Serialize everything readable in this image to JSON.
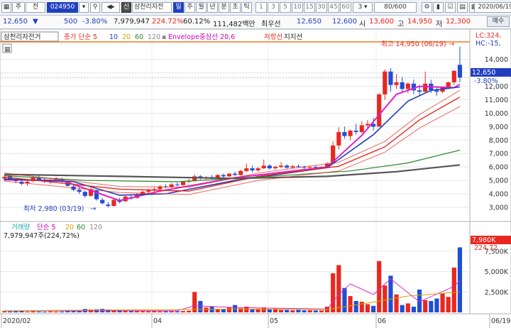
{
  "toolbar": {
    "menu_label": "주",
    "prev_label": "전",
    "code": "024950",
    "cat_badge": "신",
    "stock_name": "삼천리자전",
    "periods": [
      "일",
      "주",
      "월",
      "년",
      "분",
      "초",
      "틱"
    ],
    "minutes": [
      "1",
      "3",
      "5",
      "10",
      "15",
      "30",
      "45",
      "60"
    ],
    "interval": "3",
    "bar_count": "80",
    "bar_total": "600",
    "date": "2020/06/19"
  },
  "quote": {
    "price": "12,650",
    "change": "500",
    "change_pct": "-3.80%",
    "volume": "7,979,947",
    "volume_ratio": "224.72%",
    "turnover_rate": "60.12%",
    "trade_value": "111,482백만",
    "best_label": "최우선",
    "best_ask": "12,650",
    "best_bid": "12,600",
    "open_label": "시",
    "open": "13,600",
    "high_label": "고",
    "high": "14,950",
    "low_label": "저",
    "low": "12,300",
    "buy_label": "매수",
    "sell_label": "매수"
  },
  "price_legend": {
    "name": "삼천리자전거",
    "ma_label": "종가 단순 5",
    "ma_periods": [
      "10",
      "20",
      "60",
      "120"
    ],
    "envelope": "Envelope중심선 20,6",
    "resistance": "저항선",
    "support": "지지선",
    "lc": "LC:324,",
    "hc": "HC:-15,",
    "last_price": "12,650",
    "last_change": "-3.80%"
  },
  "annotations": {
    "max_label": "최고 14,950 (06/19)",
    "min_label": "최저 2,980 (03/19)"
  },
  "volume_legend": {
    "title": "거래량",
    "ma_label": "단순 5",
    "ma_periods": [
      "20",
      "60",
      "120"
    ],
    "value": "7,979,947주(224,72%)",
    "last_badge": "7,980K",
    "last_pct": "224.72"
  },
  "x_axis": [
    "2020/02",
    "04",
    "05",
    "06",
    "06/19"
  ],
  "colors": {
    "up": "#e8281f",
    "down": "#1f4fd6",
    "ma5": "#e020c8",
    "ma10": "#1f3fbf",
    "ma20": "#e8281f",
    "ma60": "#2a8a2a",
    "ma120": "#555555",
    "highlight": "#f07a1a"
  },
  "chart_data": [
    {
      "type": "candlestick",
      "title": "삼천리자전거",
      "y_ticks": [
        3000,
        4000,
        5000,
        6000,
        7000,
        8000,
        9000,
        10000,
        11000,
        12000,
        13000,
        14000
      ],
      "y_tick_labels": [
        "3,000",
        "4,000",
        "5,000",
        "6,000",
        "7,000",
        "8,000",
        "9,000",
        "10,000",
        "11,000",
        "12,000",
        "13,000",
        "14,000"
      ],
      "ylim": [
        2100,
        15200
      ],
      "candles": [
        {
          "o": 5150,
          "h": 5400,
          "l": 4950,
          "c": 5250
        },
        {
          "o": 5300,
          "h": 5450,
          "l": 5050,
          "c": 5100
        },
        {
          "o": 5050,
          "h": 5200,
          "l": 4800,
          "c": 4950
        },
        {
          "o": 4900,
          "h": 5050,
          "l": 4650,
          "c": 4750
        },
        {
          "o": 4800,
          "h": 5000,
          "l": 4600,
          "c": 4900
        },
        {
          "o": 4950,
          "h": 5300,
          "l": 4850,
          "c": 5200
        },
        {
          "o": 5200,
          "h": 5350,
          "l": 4950,
          "c": 5050
        },
        {
          "o": 5000,
          "h": 5150,
          "l": 4800,
          "c": 4950
        },
        {
          "o": 4900,
          "h": 5100,
          "l": 4750,
          "c": 5000
        },
        {
          "o": 5050,
          "h": 5250,
          "l": 4900,
          "c": 5150
        },
        {
          "o": 5100,
          "h": 5200,
          "l": 4850,
          "c": 4900
        },
        {
          "o": 4850,
          "h": 4950,
          "l": 4550,
          "c": 4600
        },
        {
          "o": 4550,
          "h": 4650,
          "l": 4200,
          "c": 4300
        },
        {
          "o": 4300,
          "h": 4500,
          "l": 4000,
          "c": 4150
        },
        {
          "o": 4150,
          "h": 4250,
          "l": 3700,
          "c": 3850
        },
        {
          "o": 3850,
          "h": 4450,
          "l": 3800,
          "c": 4350
        },
        {
          "o": 4250,
          "h": 4300,
          "l": 3500,
          "c": 3600
        },
        {
          "o": 3550,
          "h": 3700,
          "l": 3200,
          "c": 3300
        },
        {
          "o": 3200,
          "h": 3400,
          "l": 2980,
          "c": 3100
        },
        {
          "o": 3100,
          "h": 3650,
          "l": 3050,
          "c": 3550
        },
        {
          "o": 3500,
          "h": 3700,
          "l": 3300,
          "c": 3400
        },
        {
          "o": 3450,
          "h": 3850,
          "l": 3400,
          "c": 3800
        },
        {
          "o": 3750,
          "h": 3900,
          "l": 3550,
          "c": 3650
        },
        {
          "o": 3700,
          "h": 4050,
          "l": 3650,
          "c": 3950
        },
        {
          "o": 3950,
          "h": 4250,
          "l": 3850,
          "c": 4150
        },
        {
          "o": 4150,
          "h": 4400,
          "l": 4050,
          "c": 4250
        },
        {
          "o": 4250,
          "h": 4500,
          "l": 4150,
          "c": 4350
        },
        {
          "o": 4350,
          "h": 4650,
          "l": 4250,
          "c": 4550
        },
        {
          "o": 4550,
          "h": 4700,
          "l": 4400,
          "c": 4500
        },
        {
          "o": 4500,
          "h": 4800,
          "l": 4450,
          "c": 4700
        },
        {
          "o": 4700,
          "h": 4850,
          "l": 4550,
          "c": 4650
        },
        {
          "o": 4650,
          "h": 4950,
          "l": 4600,
          "c": 4900
        },
        {
          "o": 4900,
          "h": 5100,
          "l": 4800,
          "c": 4950
        },
        {
          "o": 4950,
          "h": 5450,
          "l": 4900,
          "c": 5300
        },
        {
          "o": 5300,
          "h": 5400,
          "l": 5050,
          "c": 5150
        },
        {
          "o": 5150,
          "h": 5300,
          "l": 5000,
          "c": 5250
        },
        {
          "o": 5250,
          "h": 5400,
          "l": 5100,
          "c": 5200
        },
        {
          "o": 5200,
          "h": 5450,
          "l": 5150,
          "c": 5400
        },
        {
          "o": 5400,
          "h": 5500,
          "l": 5200,
          "c": 5300
        },
        {
          "o": 5300,
          "h": 5550,
          "l": 5250,
          "c": 5500
        },
        {
          "o": 5500,
          "h": 5650,
          "l": 5350,
          "c": 5400
        },
        {
          "o": 5400,
          "h": 5800,
          "l": 5350,
          "c": 5700
        },
        {
          "o": 5700,
          "h": 6250,
          "l": 5600,
          "c": 5900
        },
        {
          "o": 5900,
          "h": 6100,
          "l": 5600,
          "c": 5750
        },
        {
          "o": 5750,
          "h": 6000,
          "l": 5650,
          "c": 5900
        },
        {
          "o": 5900,
          "h": 6550,
          "l": 5850,
          "c": 6100
        },
        {
          "o": 6100,
          "h": 6200,
          "l": 5800,
          "c": 5900
        },
        {
          "o": 5900,
          "h": 6100,
          "l": 5800,
          "c": 6000
        },
        {
          "o": 6000,
          "h": 6350,
          "l": 5900,
          "c": 6100
        },
        {
          "o": 6100,
          "h": 6200,
          "l": 5850,
          "c": 5950
        },
        {
          "o": 5950,
          "h": 6150,
          "l": 5900,
          "c": 6050
        },
        {
          "o": 6050,
          "h": 6200,
          "l": 5950,
          "c": 6000
        },
        {
          "o": 6000,
          "h": 6100,
          "l": 5850,
          "c": 5950
        },
        {
          "o": 5950,
          "h": 6050,
          "l": 5850,
          "c": 6000
        },
        {
          "o": 6000,
          "h": 6100,
          "l": 5900,
          "c": 5950
        },
        {
          "o": 5950,
          "h": 6050,
          "l": 5850,
          "c": 6000
        },
        {
          "o": 6000,
          "h": 6350,
          "l": 5950,
          "c": 6250
        },
        {
          "o": 6250,
          "h": 7900,
          "l": 6200,
          "c": 7600
        },
        {
          "o": 7600,
          "h": 8950,
          "l": 7300,
          "c": 8600
        },
        {
          "o": 8600,
          "h": 9000,
          "l": 8100,
          "c": 8300
        },
        {
          "o": 8300,
          "h": 8800,
          "l": 8000,
          "c": 8700
        },
        {
          "o": 8700,
          "h": 9200,
          "l": 8400,
          "c": 8600
        },
        {
          "o": 8600,
          "h": 9400,
          "l": 8500,
          "c": 9100
        },
        {
          "o": 9100,
          "h": 9500,
          "l": 8800,
          "c": 9200
        },
        {
          "o": 9200,
          "h": 9650,
          "l": 8700,
          "c": 9000
        },
        {
          "o": 9000,
          "h": 11500,
          "l": 9000,
          "c": 11400
        },
        {
          "o": 11400,
          "h": 13250,
          "l": 11000,
          "c": 13100
        },
        {
          "o": 13100,
          "h": 13350,
          "l": 11600,
          "c": 12100
        },
        {
          "o": 12100,
          "h": 12900,
          "l": 11800,
          "c": 12300
        },
        {
          "o": 12300,
          "h": 12700,
          "l": 11500,
          "c": 11800
        },
        {
          "o": 11800,
          "h": 12300,
          "l": 11500,
          "c": 12200
        },
        {
          "o": 12200,
          "h": 12500,
          "l": 11400,
          "c": 11700
        },
        {
          "o": 11700,
          "h": 12100,
          "l": 11300,
          "c": 11600
        },
        {
          "o": 11600,
          "h": 13100,
          "l": 11500,
          "c": 12200
        },
        {
          "o": 12200,
          "h": 12500,
          "l": 11500,
          "c": 11700
        },
        {
          "o": 11700,
          "h": 12000,
          "l": 11300,
          "c": 11600
        },
        {
          "o": 11600,
          "h": 12000,
          "l": 11500,
          "c": 11900
        },
        {
          "o": 11900,
          "h": 12350,
          "l": 11800,
          "c": 12300
        },
        {
          "o": 12300,
          "h": 13200,
          "l": 12100,
          "c": 13150
        },
        {
          "o": 13600,
          "h": 14950,
          "l": 12300,
          "c": 12650
        }
      ],
      "moving_averages": [
        {
          "name": "5",
          "values": [
            [
              0,
              5050
            ],
            [
              10,
              5000
            ],
            [
              17,
              3950
            ],
            [
              20,
              3500
            ],
            [
              27,
              4200
            ],
            [
              40,
              5200
            ],
            [
              56,
              6000
            ],
            [
              62,
              8350
            ],
            [
              68,
              11400
            ],
            [
              72,
              12000
            ],
            [
              78,
              11900
            ],
            [
              79,
              12150
            ]
          ]
        },
        {
          "name": "10",
          "values": [
            [
              0,
              5100
            ],
            [
              12,
              4900
            ],
            [
              20,
              3900
            ],
            [
              28,
              4000
            ],
            [
              40,
              5000
            ],
            [
              56,
              5950
            ],
            [
              64,
              8400
            ],
            [
              70,
              10900
            ],
            [
              74,
              11700
            ],
            [
              79,
              11950
            ]
          ]
        },
        {
          "name": "20",
          "values": [
            [
              0,
              5250
            ],
            [
              20,
              4350
            ],
            [
              32,
              4200
            ],
            [
              44,
              5300
            ],
            [
              58,
              6050
            ],
            [
              66,
              7500
            ],
            [
              72,
              9500
            ],
            [
              79,
              11200
            ]
          ]
        },
        {
          "name": "60",
          "values": [
            [
              0,
              5350
            ],
            [
              14,
              5000
            ],
            [
              30,
              4900
            ],
            [
              46,
              5300
            ],
            [
              60,
              5700
            ],
            [
              70,
              6300
            ],
            [
              79,
              7250
            ]
          ]
        },
        {
          "name": "120",
          "values": [
            [
              0,
              5450
            ],
            [
              20,
              5300
            ],
            [
              40,
              5150
            ],
            [
              56,
              5300
            ],
            [
              68,
              5650
            ],
            [
              79,
              6150
            ]
          ]
        }
      ],
      "envelope_lines": [
        {
          "name": "Envelope",
          "values": [
            [
              0,
              5550
            ],
            [
              20,
              4550
            ],
            [
              32,
              4500
            ],
            [
              44,
              5550
            ],
            [
              58,
              6350
            ],
            [
              66,
              7900
            ],
            [
              72,
              9900
            ],
            [
              79,
              11700
            ]
          ]
        },
        {
          "name": "Envelope",
          "values": [
            [
              0,
              4950
            ],
            [
              20,
              4100
            ],
            [
              32,
              3950
            ],
            [
              44,
              5000
            ],
            [
              58,
              5700
            ],
            [
              66,
              7100
            ],
            [
              72,
              8900
            ],
            [
              79,
              10500
            ]
          ]
        }
      ]
    },
    {
      "type": "bar",
      "title": "거래량",
      "y_tick_labels": [
        "7,500K",
        "5,000K",
        "2,500K"
      ],
      "y_ticks": [
        7500000,
        5000000,
        2500000
      ],
      "ylim": [
        0,
        8800000
      ],
      "values": [
        150000,
        120000,
        140000,
        200000,
        100000,
        130000,
        110000,
        90000,
        120000,
        100000,
        110000,
        180000,
        260000,
        300000,
        420000,
        350000,
        380000,
        430000,
        360000,
        300000,
        250000,
        220000,
        200000,
        180000,
        160000,
        150000,
        170000,
        140000,
        150000,
        160000,
        140000,
        170000,
        200000,
        2500000,
        1400000,
        600000,
        700000,
        400000,
        350000,
        600000,
        900000,
        500000,
        700000,
        400000,
        450000,
        600000,
        350000,
        450000,
        300000,
        300000,
        250000,
        300000,
        250000,
        260000,
        240000,
        230000,
        700000,
        4800000,
        5800000,
        3000000,
        2000000,
        1400000,
        1300000,
        1000000,
        800000,
        6300000,
        3300000,
        4500000,
        2200000,
        900000,
        1100000,
        700000,
        2800000,
        1500000,
        1400000,
        1700000,
        2300000,
        1900000,
        5500000,
        7980000
      ],
      "ma_series": [
        {
          "name": "5",
          "values": [
            [
              0,
              180000
            ],
            [
              30,
              200000
            ],
            [
              33,
              800000
            ],
            [
              40,
              600000
            ],
            [
              56,
              400000
            ],
            [
              58,
              2200000
            ],
            [
              60,
              3500000
            ],
            [
              64,
              2200000
            ],
            [
              67,
              4100000
            ],
            [
              72,
              1300000
            ],
            [
              78,
              3200000
            ],
            [
              79,
              3900000
            ]
          ]
        },
        {
          "name": "20",
          "values": [
            [
              0,
              200000
            ],
            [
              40,
              400000
            ],
            [
              56,
              350000
            ],
            [
              60,
              800000
            ],
            [
              66,
              1500000
            ],
            [
              70,
              2000000
            ],
            [
              79,
              2500000
            ]
          ]
        }
      ]
    }
  ]
}
